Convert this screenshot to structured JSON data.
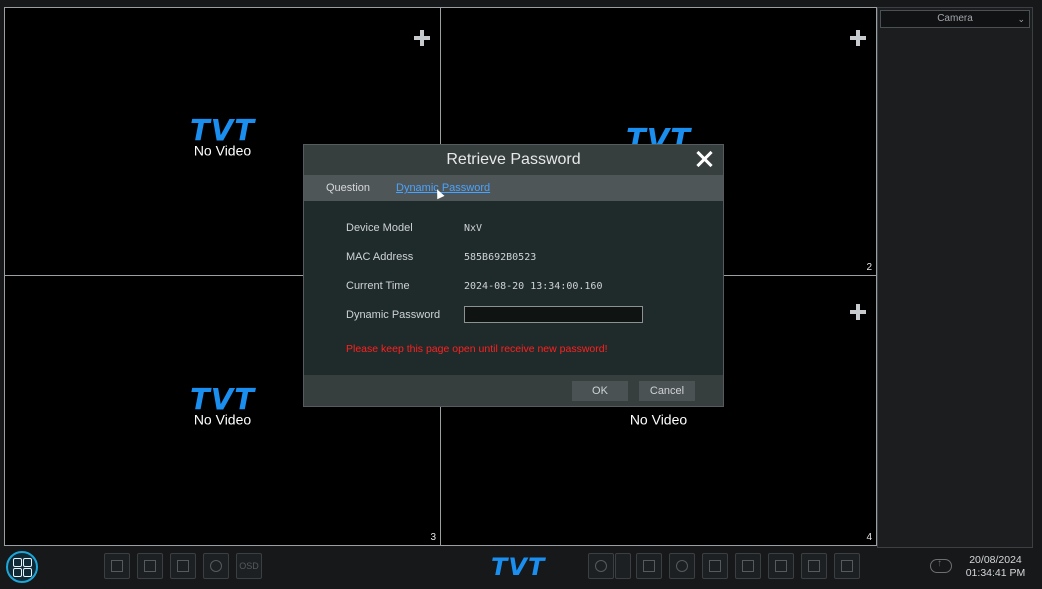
{
  "tiles": [
    {
      "logo": "TVT",
      "status": "No Video",
      "number": ""
    },
    {
      "logo": "TVT",
      "status": "",
      "number": "2"
    },
    {
      "logo": "TVT",
      "status": "No Video",
      "number": "3"
    },
    {
      "logo": "",
      "status": "No Video",
      "number": "4"
    }
  ],
  "side_panel": {
    "camera_select": "Camera"
  },
  "dialog": {
    "title": "Retrieve Password",
    "tabs": [
      "Question",
      "Dynamic Password"
    ],
    "fields": {
      "device_model_label": "Device Model",
      "device_model_value": "NxV",
      "mac_label": "MAC Address",
      "mac_value": "585B692B0523",
      "time_label": "Current Time",
      "time_value": "2024-08-20 13:34:00.160",
      "dynamic_password_label": "Dynamic Password",
      "dynamic_password_value": ""
    },
    "warning": "Please keep this page open until receive new password!",
    "warning_color": "#ff2020",
    "ok_label": "OK",
    "cancel_label": "Cancel"
  },
  "taskbar": {
    "logo": "TVT",
    "osd_label": "OSD",
    "date": "20/08/2024",
    "time": "01:34:41 PM",
    "icons": [
      "fullscreen-icon",
      "single-view-icon",
      "split-view-icon",
      "sequence-icon",
      "osd-icon",
      "playback-icon",
      "chevron-up-icon",
      "camera-icon",
      "intercom-icon",
      "record-icon",
      "backup-icon",
      "disk-icon",
      "pos-icon",
      "screen-icon",
      "cloud-upload-icon"
    ]
  },
  "colors": {
    "accent": "#1b8ff0",
    "link": "#4aa3ff"
  }
}
